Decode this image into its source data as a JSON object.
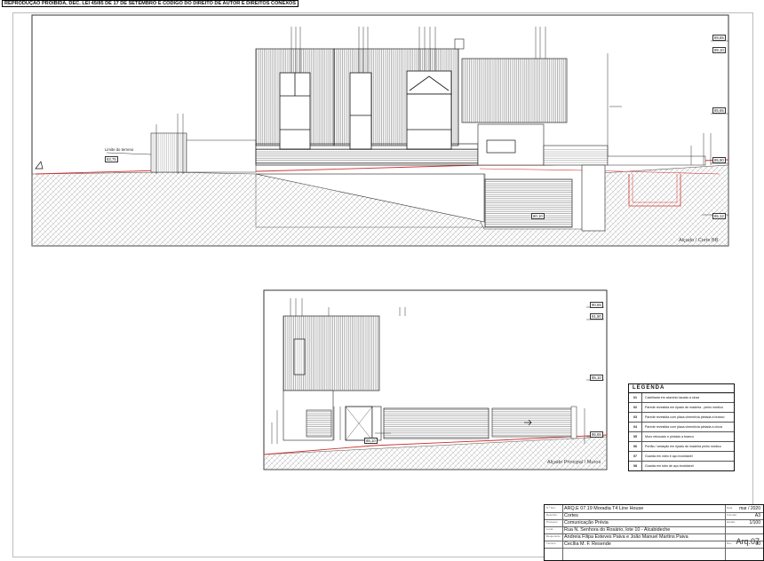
{
  "header_note": "REPRODUÇÃO PROIBIDA, DEC. LEI 45/85 DE 17 DE SETEMBRO E CÓDIGO DO DIREITO DE AUTOR E DIREITOS CONEXOS",
  "top_view": {
    "caption": "Alçado / Corte BB",
    "label_limite": "Limite do terreno",
    "levels": [
      "89,65",
      "89,10",
      "85,65",
      "83,75",
      "85,90",
      "85,12",
      "80,10"
    ]
  },
  "bottom_view": {
    "caption": "Alçado Principal / Muros",
    "levels": [
      "90,65",
      "91,90",
      "85,10",
      "86,65",
      "85,10"
    ]
  },
  "legend": {
    "title": "LEGENDA",
    "rows": [
      {
        "code": "01",
        "text": "Caixilharia em alumínio lacado a cinza"
      },
      {
        "code": "02",
        "text": "Parede revestida em ripado de madeira - pinho nórdico"
      },
      {
        "code": "03",
        "text": "Parede revestida com placa cimentícia pintada a branco"
      },
      {
        "code": "04",
        "text": "Parede revestida com placa cimentícia pintada a cinza"
      },
      {
        "code": "05",
        "text": "Muro rebocado e pintado a branco"
      },
      {
        "code": "06",
        "text": "Portão / vedação em ripado de madeira pinho nórdico"
      },
      {
        "code": "07",
        "text": "Guarda em vidro e aço inoxidável"
      },
      {
        "code": "08",
        "text": "Guarda em tubo de aço inoxidável"
      }
    ]
  },
  "title_block": {
    "rows": [
      {
        "key": "N.º Ref.",
        "value": "ARQ.E 07.19   Moradia T4 Line House",
        "rkey": "Data",
        "rvalue": "mar / 2020"
      },
      {
        "key": "Desenho",
        "value": "Cortes",
        "rkey": "Formato",
        "rvalue": "A3"
      },
      {
        "key": "Processo",
        "value": "Comunicação Prévia",
        "rkey": "Escala",
        "rvalue": "1/100"
      },
      {
        "key": "Local",
        "value": "Rua N. Senhora do Rosário, lote 10 - Alcabideche",
        "rkey": "",
        "rvalue": ""
      },
      {
        "key": "Requerente",
        "value": "Andreia Filipa Esteves Paiva e João Manuel Martins Paiva",
        "rkey": "",
        "rvalue": ""
      },
      {
        "key": "Técnico",
        "value": "Cecília M. F. Resende",
        "rkey": "Rev.",
        "rvalue": "00"
      }
    ],
    "drawing_number": "Arq.07"
  }
}
